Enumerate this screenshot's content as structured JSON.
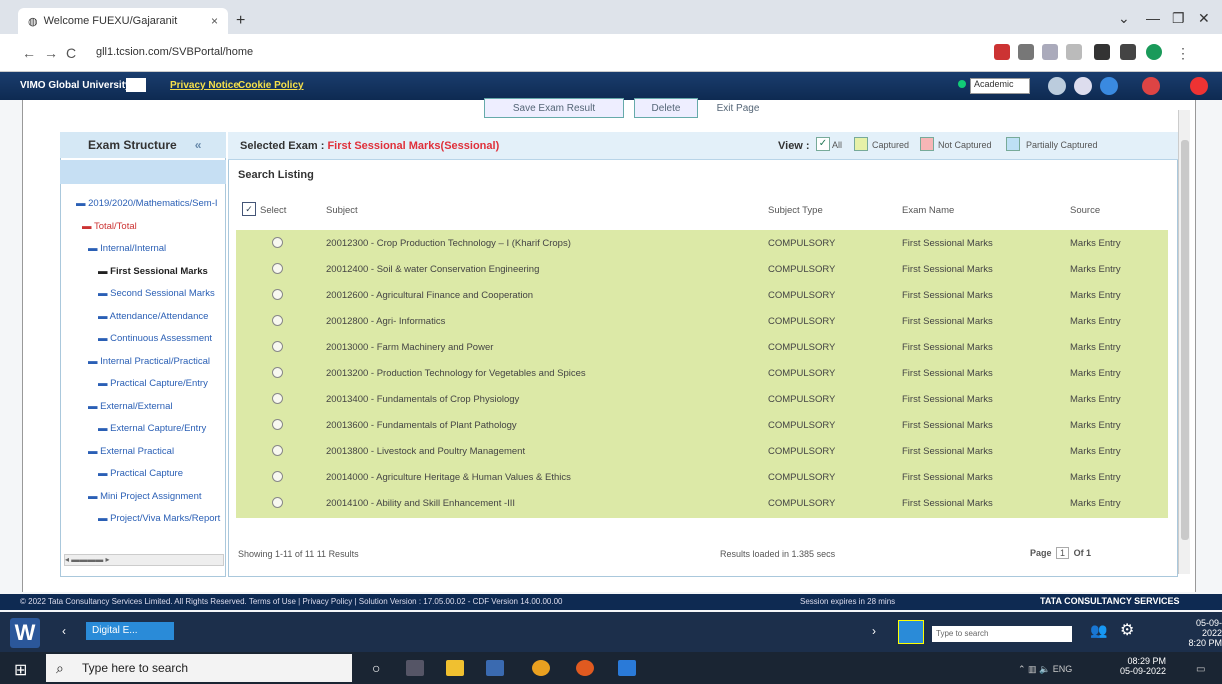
{
  "browser": {
    "tab_title": "Welcome FUEXU/Gajaranit",
    "tab_close": "×",
    "new_tab": "+",
    "url": "gll1.tcsion.com/SVBPortal/home",
    "back": "←",
    "forward": "→",
    "reload": "C",
    "win_min": "—",
    "win_max": "❐",
    "win_close": "✕"
  },
  "header": {
    "university": "VIMO Global University",
    "privacy_link": "Privacy Notice",
    "cookie_link": "Cookie Policy",
    "role_select": "Academic"
  },
  "top_buttons": [
    "Save Exam Result",
    "Delete",
    "Exit Page"
  ],
  "left_panel": {
    "title": "Exam Structure",
    "tree": [
      "2019/2020/Mathematics/Sem-I",
      "Total/Total",
      "Internal/Internal",
      "First Sessional Marks",
      "Second Sessional Marks",
      "Attendance/Attendance",
      "Continuous Assessment",
      "Internal Practical/Practical",
      "Practical Capture/Entry",
      "External/External",
      "External Capture/Entry",
      "External Practical",
      "Practical Capture",
      "Mini Project Assignment",
      "Project/Viva Marks/Report"
    ],
    "scroll_text": "◂ ▬▬▬▬ ▸"
  },
  "right_panel": {
    "selected_label": "Selected Exam :",
    "selected_exam": "First Sessional Marks(Sessional)",
    "view_label": "View :",
    "legend": [
      {
        "label": "All",
        "color": "#ffffff"
      },
      {
        "label": "Captured",
        "color": "#e6f1a8"
      },
      {
        "label": "Not Captured",
        "color": "#f7b6b6"
      },
      {
        "label": "Partially Captured",
        "color": "#bde0f5"
      }
    ],
    "listing_title": "Search Listing",
    "columns": {
      "select": "Select",
      "subject": "Subject",
      "subject_type": "Subject Type",
      "exam_name": "Exam Name",
      "source": "Source"
    },
    "rows": [
      {
        "subject": "20012300 - Crop Production Technology – I (Kharif Crops)",
        "type": "COMPULSORY",
        "exam": "First Sessional Marks",
        "source": "Marks Entry"
      },
      {
        "subject": "20012400 - Soil & water Conservation Engineering",
        "type": "COMPULSORY",
        "exam": "First Sessional Marks",
        "source": "Marks Entry"
      },
      {
        "subject": "20012600 - Agricultural Finance and Cooperation",
        "type": "COMPULSORY",
        "exam": "First Sessional Marks",
        "source": "Marks Entry"
      },
      {
        "subject": "20012800 - Agri- Informatics",
        "type": "COMPULSORY",
        "exam": "First Sessional Marks",
        "source": "Marks Entry"
      },
      {
        "subject": "20013000 - Farm Machinery and Power",
        "type": "COMPULSORY",
        "exam": "First Sessional Marks",
        "source": "Marks Entry"
      },
      {
        "subject": "20013200 - Production Technology for Vegetables and Spices",
        "type": "COMPULSORY",
        "exam": "First Sessional Marks",
        "source": "Marks Entry"
      },
      {
        "subject": "20013400 - Fundamentals of Crop Physiology",
        "type": "COMPULSORY",
        "exam": "First Sessional Marks",
        "source": "Marks Entry"
      },
      {
        "subject": "20013600 - Fundamentals of Plant Pathology",
        "type": "COMPULSORY",
        "exam": "First Sessional Marks",
        "source": "Marks Entry"
      },
      {
        "subject": "20013800 - Livestock and Poultry Management",
        "type": "COMPULSORY",
        "exam": "First Sessional Marks",
        "source": "Marks Entry"
      },
      {
        "subject": "20014000 - Agriculture Heritage & Human Values & Ethics",
        "type": "COMPULSORY",
        "exam": "First Sessional Marks",
        "source": "Marks Entry"
      },
      {
        "subject": "20014100 - Ability and Skill Enhancement -III",
        "type": "COMPULSORY",
        "exam": "First Sessional Marks",
        "source": "Marks Entry"
      }
    ],
    "showing": "Showing 1-11 of 11 11 Results",
    "loaded": "Results loaded in 1.385 secs",
    "page_label": "Page",
    "page_num": "1",
    "page_of": "Of 1"
  },
  "status_bar": {
    "copyright": "© 2022 Tata Consultancy Services Limited. All Rights Reserved. Terms of Use | Privacy Policy | Solution Version : 17.05.00.02 - CDF Version 14.00.00.00",
    "session": "Session expires in 28 mins",
    "brand": "TATA CONSULTANCY SERVICES"
  },
  "vm_taskbar": {
    "app": "Digital E...",
    "search_placeholder": "Type to search",
    "date": "05-09-2022",
    "time": "8:20 PM"
  },
  "win_taskbar": {
    "search": "Type here to search",
    "time": "08:29 PM",
    "date": "05-09-2022"
  }
}
